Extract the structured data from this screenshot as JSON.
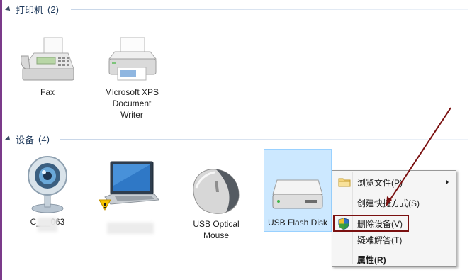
{
  "printers_section": {
    "title": "打印机",
    "count": "(2)"
  },
  "devices_section": {
    "title": "设备",
    "count": "(4)"
  },
  "printers": [
    {
      "name": "Fax",
      "icon": "fax-icon"
    },
    {
      "name_lines": [
        "Microsoft XPS",
        "Document",
        "Writer"
      ],
      "icon": "printer-icon"
    }
  ],
  "devices": [
    {
      "name": "C___063",
      "icon": "webcam-icon"
    },
    {
      "name": "",
      "icon": "laptop-icon"
    },
    {
      "name_lines": [
        "USB Optical",
        "Mouse"
      ],
      "icon": "mouse-icon"
    },
    {
      "name": "USB Flash Disk",
      "icon": "usb-drive-icon",
      "selected": true
    }
  ],
  "context_menu": {
    "items": [
      {
        "label": "浏览文件(P)",
        "icon": "folder-icon",
        "has_submenu": true
      },
      {
        "label": "创建快捷方式(S)"
      },
      {
        "label": "删除设备(V)",
        "icon": "uac-shield-icon",
        "highlighted": true
      },
      {
        "label": "疑难解答(T)"
      },
      {
        "label": "属性(R)",
        "bold": true
      }
    ]
  },
  "annotation": {
    "color": "#7a1010"
  }
}
